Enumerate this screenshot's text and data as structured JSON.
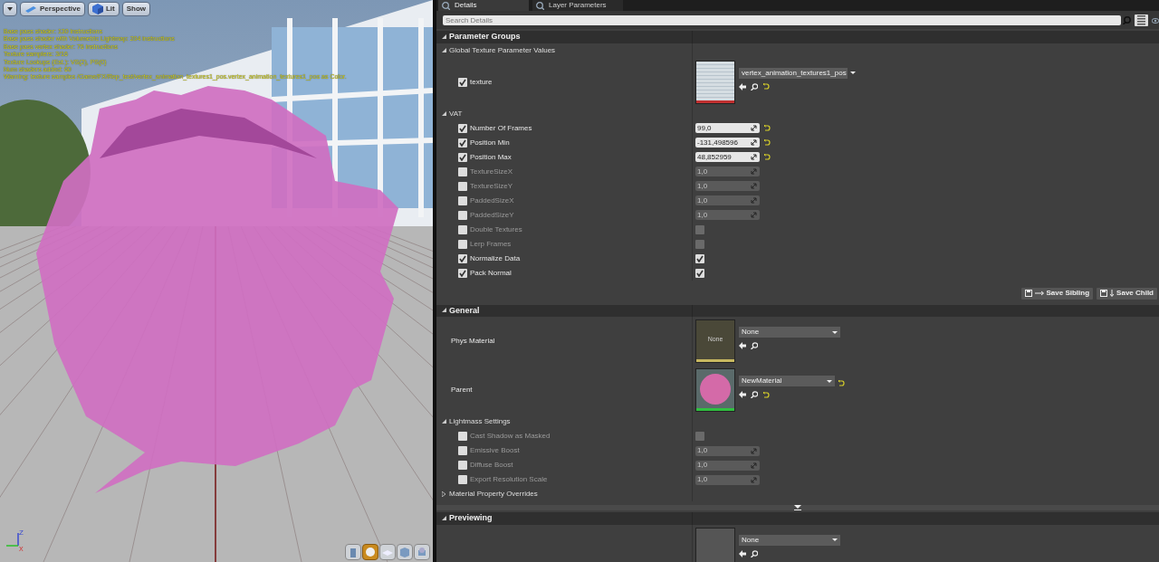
{
  "viewport": {
    "toolbar": [
      {
        "kind": "menu"
      },
      {
        "kind": "perspective",
        "label": "Perspective"
      },
      {
        "kind": "lit",
        "label": "Lit"
      },
      {
        "kind": "plain",
        "label": "Show"
      }
    ],
    "stats": [
      "Base pass shader: 130 instructions",
      "Base pass shader with Volumetric Lightmap: 204 instructions",
      "Base pass vertex shader: 76 instructions",
      "Texture samplers: 3/16",
      "Texture Lookups (Est.): VS(2), PS(0)",
      "Num shaders added: 60",
      "Warning: texture samples /Game/FX/Rep_test/vertex_animation_textures1_pos.vertex_animation_textures1_pos as Color."
    ],
    "axis": {
      "z": "Z",
      "x": "X"
    },
    "preview_shapes": [
      {
        "kind": "cylinder",
        "selected": false
      },
      {
        "kind": "sphere",
        "selected": true
      },
      {
        "kind": "plane",
        "selected": false
      },
      {
        "kind": "cube",
        "selected": false
      },
      {
        "kind": "custom",
        "selected": false
      }
    ]
  },
  "tabs": [
    {
      "label": "Details",
      "selected": true
    },
    {
      "label": "Layer Parameters",
      "selected": false
    }
  ],
  "search": {
    "placeholder": "Search Details"
  },
  "categories": [
    {
      "title": "Parameter Groups",
      "expanded": true,
      "items": [
        {
          "kind": "group",
          "label": "Global Texture Parameter Values",
          "expanded": true,
          "children": [
            {
              "kind": "texture",
              "label": "texture",
              "checked": true,
              "disabled": false,
              "value": "vertex_animation_textures1_pos",
              "thumb": {
                "kind": "texture",
                "color": "#c03030"
              },
              "reset": true
            }
          ]
        },
        {
          "kind": "group",
          "label": "VAT",
          "expanded": true,
          "children": [
            {
              "kind": "number",
              "label": "Number Of Frames",
              "checked": true,
              "disabled": false,
              "value": "99,0",
              "reset": true
            },
            {
              "kind": "number",
              "label": "Position Min",
              "checked": true,
              "disabled": false,
              "value": "-131,498596",
              "reset": true
            },
            {
              "kind": "number",
              "label": "Position Max",
              "checked": true,
              "disabled": false,
              "value": "48,852959",
              "reset": true
            },
            {
              "kind": "number",
              "label": "TextureSizeX",
              "checked": false,
              "disabled": true,
              "value": "1,0"
            },
            {
              "kind": "number",
              "label": "TextureSizeY",
              "checked": false,
              "disabled": true,
              "value": "1,0"
            },
            {
              "kind": "number",
              "label": "PaddedSizeX",
              "checked": false,
              "disabled": true,
              "value": "1,0"
            },
            {
              "kind": "number",
              "label": "PaddedSizeY",
              "checked": false,
              "disabled": true,
              "value": "1,0"
            },
            {
              "kind": "bool",
              "label": "Double Textures",
              "checked": false,
              "disabled": true,
              "value_checked": false
            },
            {
              "kind": "bool",
              "label": "Lerp Frames",
              "checked": false,
              "disabled": true,
              "value_checked": false
            },
            {
              "kind": "bool",
              "label": "Normalize Data",
              "checked": true,
              "disabled": false,
              "value_checked": true
            },
            {
              "kind": "bool",
              "label": "Pack Normal",
              "checked": true,
              "disabled": false,
              "value_checked": true
            }
          ]
        }
      ],
      "buttons": [
        {
          "kind": "sibling",
          "label": "Save Sibling"
        },
        {
          "kind": "child",
          "label": "Save Child"
        }
      ]
    },
    {
      "title": "General",
      "expanded": true,
      "items": [
        {
          "kind": "asset",
          "label": "Phys Material",
          "value": "None",
          "thumb": {
            "kind": "blank",
            "text": "None",
            "color": "#c8b860"
          }
        },
        {
          "kind": "asset",
          "label": "Parent",
          "value": "NewMaterial",
          "thumb": {
            "kind": "sphere",
            "color": "#30c040"
          },
          "reset": true
        },
        {
          "kind": "group",
          "label": "Lightmass Settings",
          "expanded": true,
          "children": [
            {
              "kind": "bool",
              "label": "Cast Shadow as Masked",
              "checked": false,
              "disabled": true,
              "value_checked": false
            },
            {
              "kind": "number",
              "label": "Emissive Boost",
              "checked": false,
              "disabled": true,
              "value": "1,0"
            },
            {
              "kind": "number",
              "label": "Diffuse Boost",
              "checked": false,
              "disabled": true,
              "value": "1,0"
            },
            {
              "kind": "number",
              "label": "Export Resolution Scale",
              "checked": false,
              "disabled": true,
              "value": "1,0"
            }
          ]
        },
        {
          "kind": "group",
          "label": "Material Property Overrides",
          "expanded": false
        }
      ]
    },
    {
      "title": "Previewing",
      "expanded": true,
      "items": [
        {
          "kind": "asset",
          "value": "None",
          "thumb": {
            "kind": "plain",
            "color": "#555555"
          }
        }
      ]
    }
  ]
}
